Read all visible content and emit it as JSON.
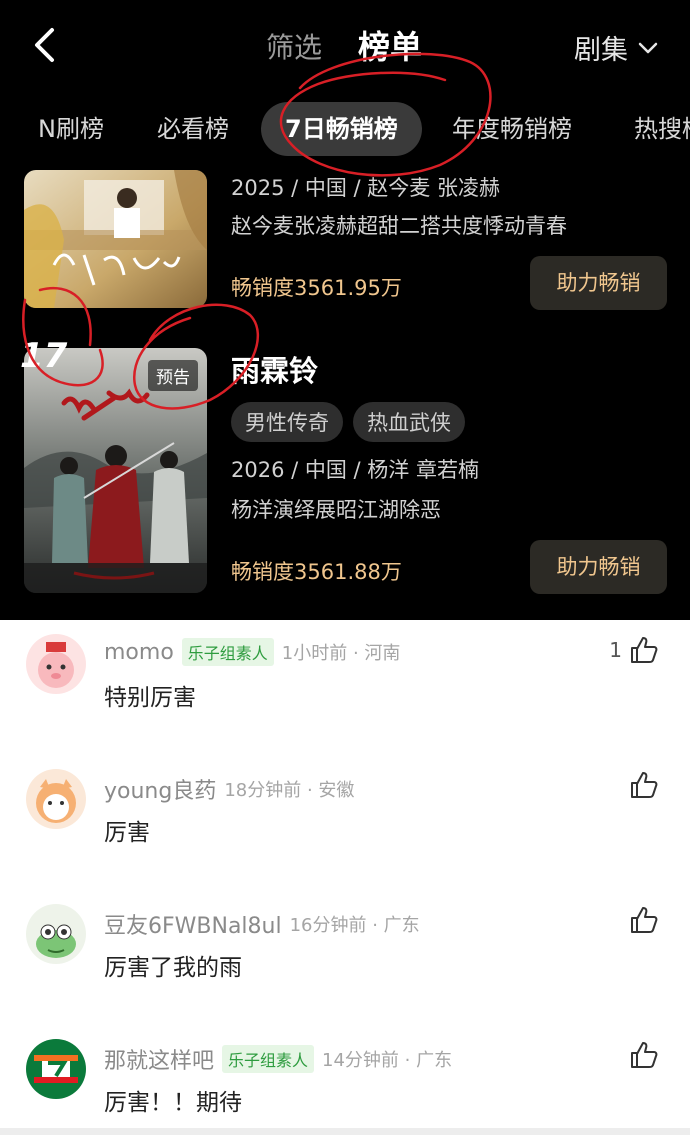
{
  "header": {
    "filter_label": "筛选",
    "title": "榜单",
    "category_label": "剧集"
  },
  "tabs": [
    {
      "label": "N刷榜",
      "active": false
    },
    {
      "label": "必看榜",
      "active": false
    },
    {
      "label": "7日畅销榜",
      "active": true
    },
    {
      "label": "年度畅销榜",
      "active": false
    },
    {
      "label": "热搜榜",
      "active": false
    }
  ],
  "items": [
    {
      "meta": "2025 / 中国 / 赵今麦 张凌赫",
      "description": "赵今麦张凌赫超甜二搭共度悸动青春",
      "sales": "畅销度3561.95万",
      "button": "助力畅销"
    },
    {
      "rank": "17",
      "badge": "预告",
      "title": "雨霖铃",
      "tags": [
        "男性传奇",
        "热血武侠"
      ],
      "meta": "2026 / 中国 / 杨洋 章若楠",
      "description": "杨洋演绎展昭江湖除恶",
      "sales": "畅销度3561.88万",
      "button": "助力畅销"
    }
  ],
  "comments": [
    {
      "user": "momo",
      "badge": "乐子组素人",
      "time": "1小时前 · 河南",
      "text": "特别厉害",
      "likes": "1"
    },
    {
      "user": "young良药",
      "badge": "",
      "time": "18分钟前 · 安徽",
      "text": "厉害",
      "likes": ""
    },
    {
      "user": "豆友6FWBNal8ul",
      "badge": "",
      "time": "16分钟前 · 广东",
      "text": "厉害了我的雨",
      "likes": ""
    },
    {
      "user": "那就这样吧",
      "badge": "乐子组素人",
      "time": "14分钟前 · 广东",
      "text": "厉害！！期待",
      "likes": ""
    }
  ],
  "colors": {
    "background_dark": "#000000",
    "accent_gold": "#f0c68e",
    "badge_green": "#2e9c3f",
    "scribble_red": "#d81f26"
  }
}
